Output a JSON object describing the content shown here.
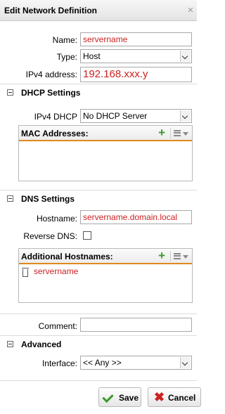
{
  "dialog": {
    "title": "Edit Network Definition",
    "close_glyph": "×"
  },
  "fields": {
    "name_label": "Name:",
    "name_value": "servername",
    "type_label": "Type:",
    "type_value": "Host",
    "ipv4_label": "IPv4 address:",
    "ipv4_value": "192.168.xxx.y"
  },
  "dhcp": {
    "section_title": "DHCP Settings",
    "ipv4_dhcp_label": "IPv4 DHCP",
    "ipv4_dhcp_value": "No DHCP Server",
    "mac_grid_title": "MAC Addresses:",
    "add_glyph": "+"
  },
  "dns": {
    "section_title": "DNS Settings",
    "hostname_label": "Hostname:",
    "hostname_value": "servername.domain.local",
    "reverse_dns_label": "Reverse DNS:",
    "reverse_dns_checked": false,
    "additional_title": "Additional Hostnames:",
    "add_glyph": "+",
    "hostnames": [
      "servername"
    ]
  },
  "comment": {
    "label": "Comment:",
    "value": ""
  },
  "advanced": {
    "section_title": "Advanced",
    "interface_label": "Interface:",
    "interface_value": "<< Any >>"
  },
  "buttons": {
    "save_label": "Save",
    "cancel_label": "Cancel",
    "cancel_glyph": "✖"
  },
  "colors": {
    "accent_orange": "#e08a1e",
    "value_red": "#cc2222",
    "add_green": "#3a9a2a"
  }
}
